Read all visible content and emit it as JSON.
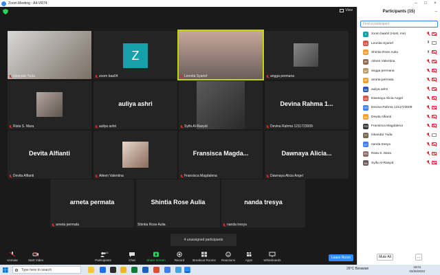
{
  "window": {
    "title": "Zoom Meeting - A4-VR74"
  },
  "meeting": {
    "view_label": "View",
    "unassigned_text": "4 unassigned participants",
    "tiles": [
      {
        "name": "Iskandar Yuda",
        "muted": true,
        "kind": "video"
      },
      {
        "name": "zoom baa04",
        "muted": true,
        "kind": "avatar",
        "avatar_letter": "Z"
      },
      {
        "name": "Leonita Syarief",
        "muted": true,
        "kind": "video",
        "active": true
      },
      {
        "name": "angga permana",
        "muted": true,
        "kind": "thumb"
      },
      {
        "name": "Rista S. Mara",
        "muted": true,
        "kind": "thumb"
      },
      {
        "name": "auliya ashri",
        "muted": true,
        "kind": "text",
        "big": "auliya ashri"
      },
      {
        "name": "Syifa Al-Rasyid",
        "muted": true,
        "kind": "thumb"
      },
      {
        "name": "Devina Rahma 1211723009",
        "muted": true,
        "kind": "text",
        "big": "Devina  Rahma  1..."
      },
      {
        "name": "Devita Alfianti",
        "muted": true,
        "kind": "text",
        "big": "Devita Alfianti"
      },
      {
        "name": "Aileen Valentina",
        "muted": true,
        "kind": "thumb"
      },
      {
        "name": "Fransisca Magdalena",
        "muted": true,
        "kind": "text",
        "big": "Fransisca  Magda..."
      },
      {
        "name": "Dawnaya Alicia Angel",
        "muted": true,
        "kind": "text",
        "big": "Dawnaya  Alicia..."
      },
      {
        "name": "arneta permata",
        "muted": true,
        "kind": "text",
        "big": "arneta permata"
      },
      {
        "name": "Shintia Rose Aulia",
        "muted": false,
        "kind": "text",
        "big": "Shintia Rose Aulia"
      },
      {
        "name": "nanda tresya",
        "muted": true,
        "kind": "text",
        "big": "nanda tresya"
      }
    ]
  },
  "toolbar": {
    "unmute": "Unmute",
    "start_video": "Start Video",
    "participants": "Participants",
    "participants_count": "15",
    "chat": "Chat",
    "share_screen": "Share Screen",
    "record": "Record",
    "breakout_rooms": "Breakout Rooms",
    "reactions": "Reactions",
    "apps": "Apps",
    "whiteboards": "Whiteboards",
    "leave": "Leave Room"
  },
  "participants_panel": {
    "title": "Participants (15)",
    "search_placeholder": "Find a participant",
    "mute_all": "Mute All",
    "more": "...",
    "list": [
      {
        "initials": "Z",
        "color": "#16a0aa",
        "name": "zoom baa04 (Host, me)",
        "mic": "off",
        "cam": "off"
      },
      {
        "initials": "LS",
        "color": "#d9534f",
        "name": "Leonita Syarief",
        "mic": "on",
        "cam": "on"
      },
      {
        "initials": "SR",
        "color": "#f0a030",
        "name": "Shintia Rose Aulia",
        "mic": "on",
        "cam": "off"
      },
      {
        "initials": "AV",
        "color": "#8e6b4e",
        "name": "Aileen Valentina",
        "mic": "off",
        "cam": "off"
      },
      {
        "initials": "AP",
        "color": "#b99a6a",
        "name": "angga permana",
        "mic": "off",
        "cam": "off"
      },
      {
        "initials": "AP",
        "color": "#f0a030",
        "name": "arneta permata",
        "mic": "off",
        "cam": "off"
      },
      {
        "initials": "AA",
        "color": "#2d5aa8",
        "name": "auliya ashri",
        "mic": "off",
        "cam": "off"
      },
      {
        "initials": "DA",
        "color": "#d9534f",
        "name": "Dawnaya Alicia Angel",
        "mic": "off",
        "cam": "off"
      },
      {
        "initials": "DR",
        "color": "#3d7ff0",
        "name": "Devina Rahma 1211723009",
        "mic": "off",
        "cam": "off"
      },
      {
        "initials": "DA",
        "color": "#f0a030",
        "name": "Devita Alfianti",
        "mic": "off",
        "cam": "off"
      },
      {
        "initials": "FM",
        "color": "#3a3a3a",
        "name": "Fransisca Magdalena",
        "mic": "off",
        "cam": "off"
      },
      {
        "initials": "IY",
        "color": "#7a6a5a",
        "name": "Iskandar Yuda",
        "mic": "off",
        "cam": "on"
      },
      {
        "initials": "NT",
        "color": "#3d7ff0",
        "name": "nanda tresya",
        "mic": "off",
        "cam": "off"
      },
      {
        "initials": "RS",
        "color": "#8e6b6b",
        "name": "Rista S. Mara",
        "mic": "off",
        "cam": "off"
      },
      {
        "initials": "SA",
        "color": "#6b5a5a",
        "name": "Syifa Al-Rasyid",
        "mic": "off",
        "cam": "off"
      }
    ]
  },
  "taskbar": {
    "search_placeholder": "Type here to search",
    "weather": "26°C  Berawan",
    "time": "19:01",
    "date": "03/30/2023"
  }
}
